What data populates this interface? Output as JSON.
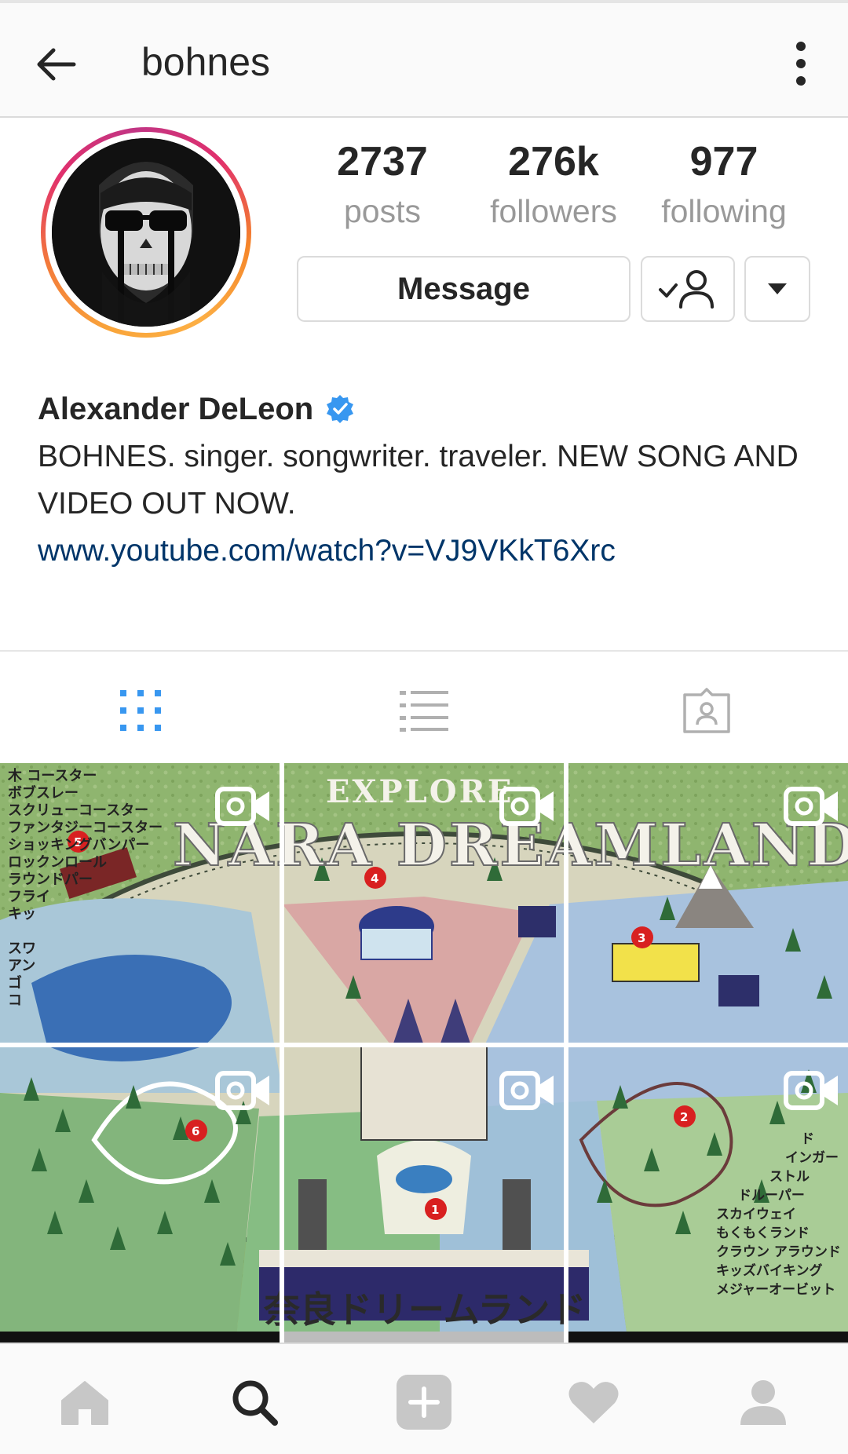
{
  "header": {
    "username": "bohnes",
    "back_icon": "arrow-left-icon",
    "more_icon": "more-vertical-icon"
  },
  "profile": {
    "avatar_icon": "profile-avatar",
    "stats": [
      {
        "value": "2737",
        "label": "posts"
      },
      {
        "value": "276k",
        "label": "followers"
      },
      {
        "value": "977",
        "label": "following"
      }
    ],
    "message_label": "Message",
    "follow_icon": "following-check-icon",
    "dropdown_icon": "caret-down-icon",
    "name": "Alexander DeLeon",
    "verified": true,
    "bio": "BOHNES. singer. songwriter. traveler. NEW SONG AND VIDEO OUT NOW.",
    "link": "www.youtube.com/watch?v=VJ9VKkT6Xrc"
  },
  "tabs": [
    {
      "name": "grid",
      "icon": "grid-icon",
      "active": true
    },
    {
      "name": "list",
      "icon": "list-icon",
      "active": false
    },
    {
      "name": "tagged",
      "icon": "tagged-icon",
      "active": false
    }
  ],
  "grid": {
    "title_top": "EXPLORE",
    "title_main": "NARA DREAMLAND",
    "title_jp": "奈良ドリームランド",
    "legend_left": [
      "木 コースター",
      "ボブスレー",
      "スクリューコースター",
      "ファンタジーコースター",
      "ショッキングバンパー",
      "ロックンロール",
      "ラウンドパー",
      "フライ",
      "キッ",
      "スワ",
      "アン",
      "ゴ",
      "コ"
    ],
    "legend_right": [
      "ド",
      "インガー",
      "ストル",
      "ドルーパー",
      "スカイウェイ",
      "もくもくランド",
      "クラウン アラウンド",
      "キッズバイキング",
      "メジャーオービット"
    ],
    "markers": [
      "1",
      "2",
      "3",
      "4",
      "5",
      "6"
    ],
    "video_badges": 6
  },
  "bottom_nav": [
    {
      "name": "home",
      "icon": "home-icon"
    },
    {
      "name": "search",
      "icon": "search-icon",
      "active": true
    },
    {
      "name": "add",
      "icon": "add-post-icon"
    },
    {
      "name": "activity",
      "icon": "heart-icon"
    },
    {
      "name": "profile",
      "icon": "profile-icon"
    }
  ],
  "colors": {
    "accent_blue": "#3897f0",
    "link_blue": "#003569",
    "muted_text": "#999999",
    "text": "#262626",
    "border": "#dbdbdb"
  }
}
